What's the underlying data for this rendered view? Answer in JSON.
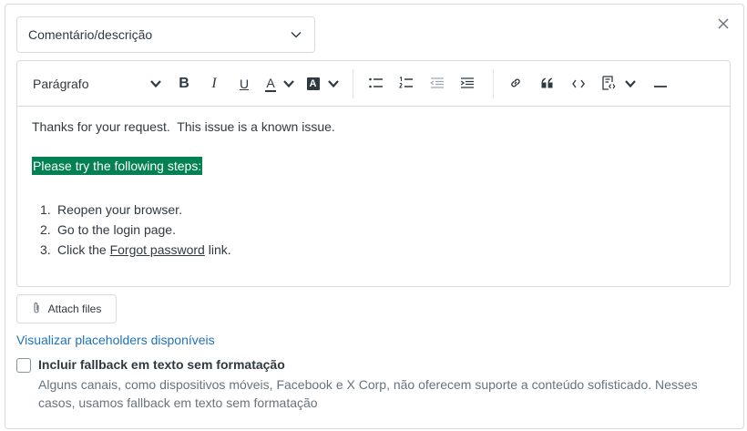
{
  "select": {
    "value": "Comentário/descrição",
    "icon": "chevron-down-icon"
  },
  "toolbar": {
    "paragraph_label": "Parágrafo",
    "bold_label": "B",
    "italic_label": "I",
    "underline_label": "U",
    "text_color_label": "A",
    "highlight_label": "A"
  },
  "editor": {
    "line1": "Thanks for your request.  This issue is a known issue.",
    "highlighted": "Please try the following steps:",
    "steps": [
      {
        "num": "1.",
        "text": "Reopen your browser."
      },
      {
        "num": "2.",
        "text": "Go to the login page."
      },
      {
        "num": "3.",
        "pre": "Click the ",
        "link": "Forgot password",
        "post": " link."
      }
    ]
  },
  "attach": {
    "label": "Attach files"
  },
  "placeholders_link": "Visualizar placeholders disponíveis",
  "fallback": {
    "label": "Incluir fallback em texto sem formatação",
    "hint": "Alguns canais, como dispositivos móveis, Facebook e X Corp, não oferecem suporte a conteúdo sofisticado. Nesses casos, usamos fallback em texto sem formatação"
  },
  "colors": {
    "highlight_bg": "#038153",
    "link": "#1f73b7",
    "border": "#d8dcde"
  }
}
